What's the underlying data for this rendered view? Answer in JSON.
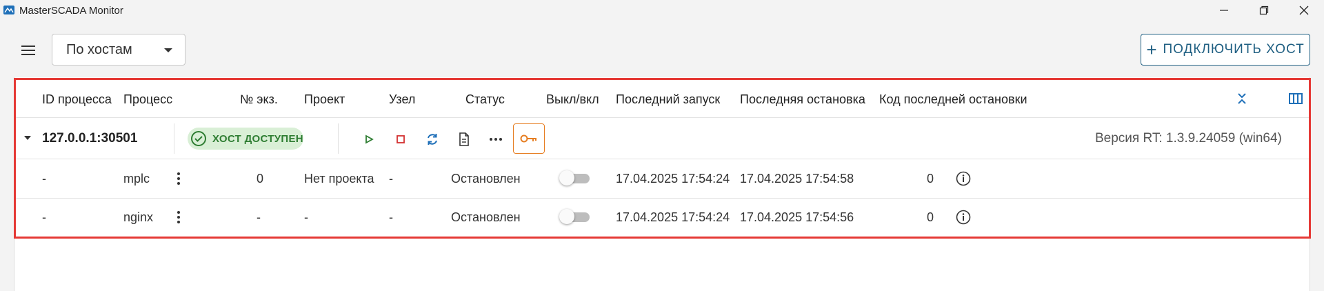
{
  "window": {
    "title": "MasterSCADA Monitor"
  },
  "toolbar": {
    "group_select_value": "По хостам",
    "connect_label": "ПОДКЛЮЧИТЬ ХОСТ"
  },
  "table": {
    "columns": [
      "ID процесса",
      "Процесс",
      "№ экз.",
      "Проект",
      "Узел",
      "Статус",
      "Выкл/вкл",
      "Последний запуск",
      "Последняя остановка",
      "Код последней остановки"
    ],
    "host": {
      "address": "127.0.0.1:30501",
      "status_badge": "ХОСТ ДОСТУПЕН",
      "version": "Версия RT: 1.3.9.24059 (win64)"
    },
    "processes": [
      {
        "pid": "-",
        "name": "mplc",
        "instance": "0",
        "project": "Нет проекта",
        "node": "-",
        "status": "Остановлен",
        "enabled": false,
        "last_start": "17.04.2025 17:54:24",
        "last_stop": "17.04.2025 17:54:58",
        "stop_code": "0"
      },
      {
        "pid": "-",
        "name": "nginx",
        "instance": "-",
        "project": "-",
        "node": "-",
        "status": "Остановлен",
        "enabled": false,
        "last_start": "17.04.2025 17:54:24",
        "last_stop": "17.04.2025 17:54:56",
        "stop_code": "0"
      }
    ]
  },
  "icons": {
    "app": "app-icon",
    "menu": "hamburger-menu-icon",
    "collapse": "collapse-all-icon",
    "columns": "columns-icon",
    "play": "play-icon",
    "stop": "stop-icon",
    "restart": "restart-icon",
    "log": "document-icon",
    "more": "more-horizontal-icon",
    "key": "key-icon",
    "info": "info-icon",
    "row_menu": "more-vertical-icon"
  },
  "colors": {
    "accent": "#1f5f82",
    "success": "#2e7d32",
    "success_bg": "#d9efd6",
    "warning": "#e67e22",
    "danger": "#d32f2f",
    "highlight": "#e53935"
  }
}
